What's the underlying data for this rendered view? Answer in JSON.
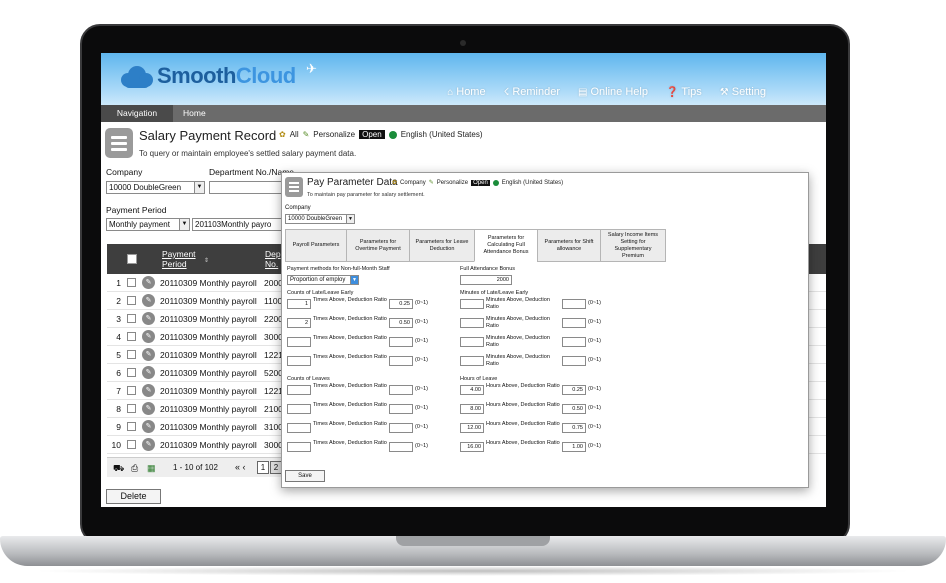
{
  "app": {
    "logo": "SmoothCloud",
    "logo_part1": "Smooth",
    "logo_part2": "Cloud",
    "nav": [
      {
        "label": "Home",
        "icon": "home-icon"
      },
      {
        "label": "Reminder",
        "icon": "reminder-icon"
      },
      {
        "label": "Online Help",
        "icon": "book-icon"
      },
      {
        "label": "Tips",
        "icon": "help-icon"
      },
      {
        "label": "Setting",
        "icon": "wrench-icon"
      }
    ]
  },
  "navbar": {
    "active": "Navigation",
    "home": "Home"
  },
  "page": {
    "title": "Salary Payment Record",
    "all": "All",
    "personalize": "Personalize",
    "open": "Open",
    "language": "English (United States)",
    "subtitle": "To query or maintain employee's settled salary payment data.",
    "company_label": "Company",
    "company_value": "10000 DoubleGreen",
    "dept_label": "Department No./Name",
    "period_label": "Payment Period",
    "period_value": "Monthly payment",
    "period_code": "201103Monthly payro"
  },
  "table": {
    "col_period": "Payment Period",
    "col_period_l1": "Payment",
    "col_period_l2": "Period",
    "col_dept_l1": "Dep",
    "col_dept_l2": "No.",
    "rows": [
      {
        "num": "1",
        "period": "20110309 Monthly payroll",
        "dept": "2000"
      },
      {
        "num": "2",
        "period": "20110309 Monthly payroll",
        "dept": "1100"
      },
      {
        "num": "3",
        "period": "20110309 Monthly payroll",
        "dept": "2200"
      },
      {
        "num": "4",
        "period": "20110309 Monthly payroll",
        "dept": "3000"
      },
      {
        "num": "5",
        "period": "20110309 Monthly payroll",
        "dept": "1221"
      },
      {
        "num": "6",
        "period": "20110309 Monthly payroll",
        "dept": "5200"
      },
      {
        "num": "7",
        "period": "20110309 Monthly payroll",
        "dept": "1221"
      },
      {
        "num": "8",
        "period": "20110309 Monthly payroll",
        "dept": "2100"
      },
      {
        "num": "9",
        "period": "20110309 Monthly payroll",
        "dept": "3100"
      },
      {
        "num": "10",
        "period": "20110309 Monthly payroll",
        "dept": "3000"
      }
    ],
    "pager_info": "1 - 10 of 102",
    "page1": "1",
    "page2": "2",
    "delete": "Delete"
  },
  "modal": {
    "title": "Pay Parameter Data",
    "company_tag": "Company",
    "personalize": "Personalize",
    "open": "Open",
    "language": "English (United States)",
    "subtitle": "To maintain pay parameter for salary settlement.",
    "company_label": "Company",
    "company_value": "10000 DoubleGreen",
    "tabs": [
      "Payroll Parameters",
      "Parameters for Overtime Payment",
      "Parameters for Leave Deduction",
      "Parameters for Calculating Full Attendance Bonus",
      "Parameters for Shift allowance",
      "Salary Income Items Setting for Supplementary Premium"
    ],
    "pay_method_label": "Payment methods for Non-full-Month Staff",
    "pay_method_value": "Proportion of employ",
    "full_bonus_label": "Full Attendance Bonus",
    "full_bonus_value": "2000",
    "late_counts_label": "Counts of Late/Leave Early",
    "late_minutes_label": "Minutes of Late/Leave Early",
    "leave_counts_label": "Counts of Leaves",
    "leave_hours_label": "Hours of Leave",
    "times_label": "Times Above, Deduction Ratio",
    "minutes_label": "Minutes Above, Deduction Ratio",
    "hours_label": "Hours Above, Deduction Ratio",
    "range": "(0~1)",
    "late_rows": [
      {
        "count": "1",
        "ratio": "0.25"
      },
      {
        "count": "2",
        "ratio": "0.50"
      },
      {
        "count": "",
        "ratio": ""
      },
      {
        "count": "",
        "ratio": ""
      }
    ],
    "minute_rows": [
      {
        "count": "",
        "ratio": ""
      },
      {
        "count": "",
        "ratio": ""
      },
      {
        "count": "",
        "ratio": ""
      },
      {
        "count": "",
        "ratio": ""
      }
    ],
    "leave_rows": [
      {
        "count": "",
        "ratio": ""
      },
      {
        "count": "",
        "ratio": ""
      },
      {
        "count": "",
        "ratio": ""
      },
      {
        "count": "",
        "ratio": ""
      }
    ],
    "hour_rows": [
      {
        "count": "4.00",
        "ratio": "0.25"
      },
      {
        "count": "8.00",
        "ratio": "0.50"
      },
      {
        "count": "12.00",
        "ratio": "0.75"
      },
      {
        "count": "16.00",
        "ratio": "1.00"
      }
    ],
    "save": "Save"
  }
}
